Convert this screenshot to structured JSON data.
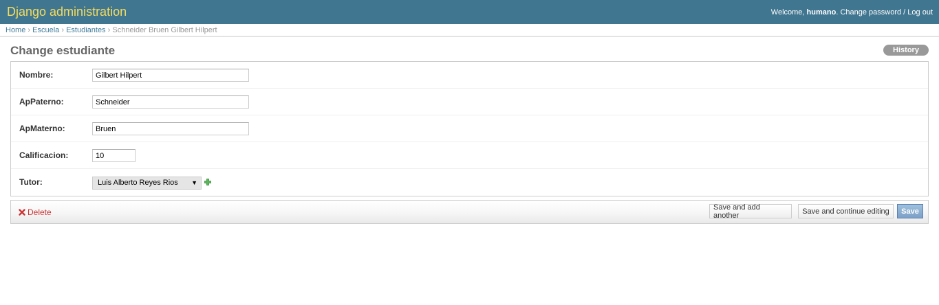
{
  "header": {
    "brand": "Django administration",
    "welcome": "Welcome,",
    "username": "humano",
    "change_password": "Change password",
    "separator": "/",
    "logout": "Log out"
  },
  "breadcrumbs": {
    "items": [
      "Home",
      "Escuela",
      "Estudiantes"
    ],
    "current": "Schneider Bruen Gilbert Hilpert",
    "separator": "›"
  },
  "page": {
    "title": "Change estudiante",
    "history_label": "History"
  },
  "form": {
    "nombre": {
      "label": "Nombre:",
      "value": "Gilbert Hilpert"
    },
    "appaterno": {
      "label": "ApPaterno:",
      "value": "Schneider"
    },
    "apmaterno": {
      "label": "ApMaterno:",
      "value": "Bruen"
    },
    "calificacion": {
      "label": "Calificacion:",
      "value": "10"
    },
    "tutor": {
      "label": "Tutor:",
      "value": "Luis Alberto Reyes Rios",
      "arrow": "▼"
    }
  },
  "submit": {
    "delete_label": "Delete",
    "save_add_another": "Save and add another",
    "save_continue": "Save and continue editing",
    "save": "Save"
  },
  "colors": {
    "header_bg": "#417690",
    "brand": "#f5dd5d",
    "link": "#447e9b",
    "delete": "#cc3434",
    "save_button": "#7ca0c7",
    "add_icon": "#5bb75b"
  }
}
